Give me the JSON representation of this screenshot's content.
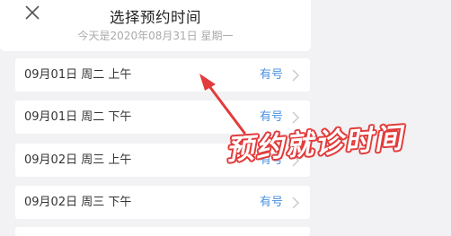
{
  "header": {
    "title": "选择预约时间",
    "subtitle": "今天是2020年08月31日 星期一"
  },
  "slots": [
    {
      "date": "09月01日 周二 上午",
      "status": "有号"
    },
    {
      "date": "09月01日 周二 下午",
      "status": "有号"
    },
    {
      "date": "09月02日 周三 上午",
      "status": "有号"
    },
    {
      "date": "09月02日 周三 下午",
      "status": "有号"
    }
  ],
  "annotation": {
    "text": "预约就诊时间",
    "color": "#e23b3b"
  },
  "icons": {
    "close": "close-icon",
    "chevron": "chevron-right-icon"
  },
  "colors": {
    "status": "#4a90e2",
    "background": "#f2f2f4"
  }
}
